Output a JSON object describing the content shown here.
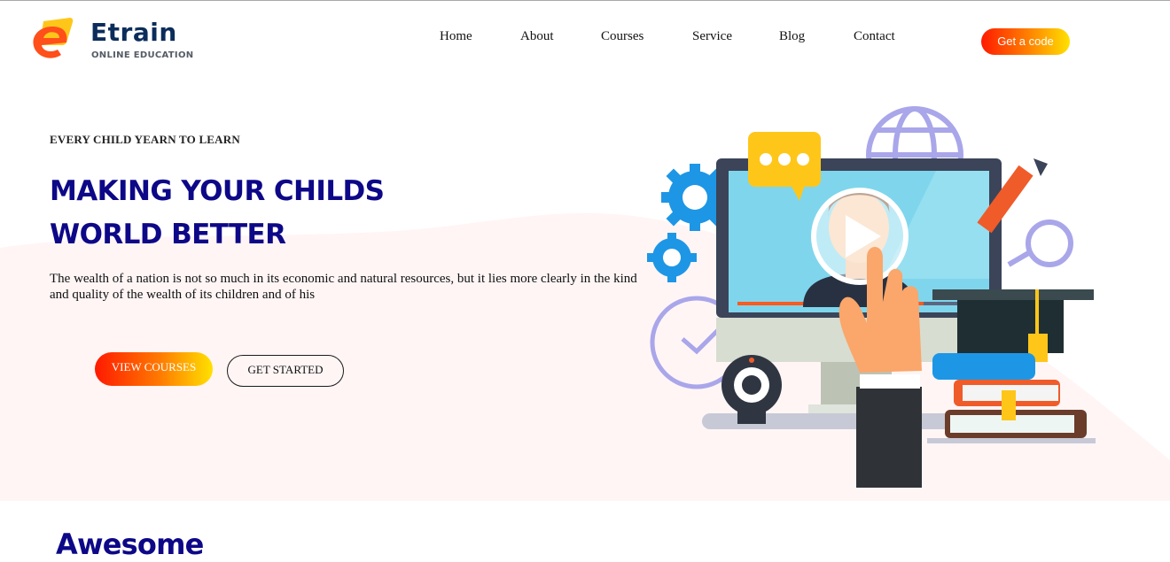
{
  "brand": {
    "name": "Etrain",
    "tagline": "ONLINE EDUCATION",
    "colors": {
      "navy": "#0c2d5b",
      "orange": "#ff5a1f",
      "yellow": "#ffc61a"
    }
  },
  "nav": {
    "items": [
      {
        "label": "Home"
      },
      {
        "label": "About"
      },
      {
        "label": "Courses"
      },
      {
        "label": "Service"
      },
      {
        "label": "Blog"
      },
      {
        "label": "Contact"
      }
    ],
    "cta_label": "Get a code"
  },
  "hero": {
    "eyebrow": "EVERY CHILD YEARN TO LEARN",
    "title_line1": "MAKING YOUR CHILDS",
    "title_line2": "WORLD BETTER",
    "description": "The wealth of a nation is not so much in its economic and natural resources, but it lies more clearly in the kind and quality of the wealth of its children and of his",
    "primary_button": "VIEW COURSES",
    "secondary_button": "GET STARTED",
    "background_color": "#fff5f5",
    "title_color": "#0d0887"
  },
  "next_section": {
    "title": "Awesome"
  }
}
